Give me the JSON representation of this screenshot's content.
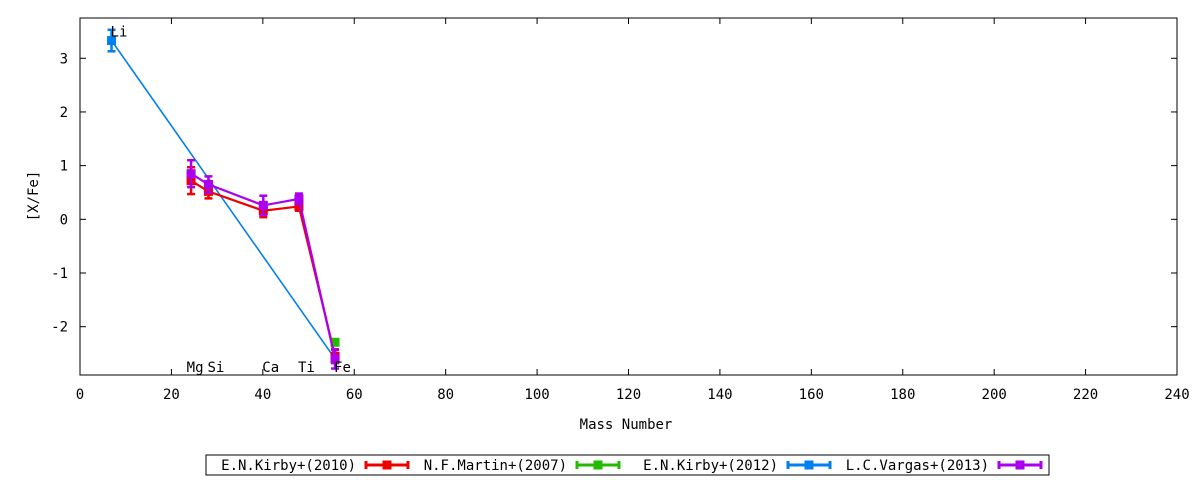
{
  "chart_data": {
    "type": "line",
    "xlabel": "Mass Number",
    "ylabel": "[X/Fe]",
    "xlim": [
      0,
      240
    ],
    "ylim": [
      -2.9,
      3.75
    ],
    "x_ticks": [
      0,
      20,
      40,
      60,
      80,
      100,
      120,
      140,
      160,
      180,
      200,
      220,
      240
    ],
    "y_ticks": [
      -2,
      -1,
      0,
      1,
      2,
      3
    ],
    "grid": false,
    "legend_position": "bottom",
    "element_labels": [
      {
        "text": "Li",
        "x": 6.9,
        "y": 3.5
      },
      {
        "text": "Mg",
        "x": 24.3,
        "y": -2.75
      },
      {
        "text": "Si",
        "x": 28.1,
        "y": -2.75
      },
      {
        "text": "Ca",
        "x": 40.1,
        "y": -2.75
      },
      {
        "text": "Ti",
        "x": 47.9,
        "y": -2.75
      },
      {
        "text": "Fe",
        "x": 55.8,
        "y": -2.75
      }
    ],
    "series": [
      {
        "name": "E.N.Kirby+(2010)",
        "color": "#ee0000",
        "points": [
          {
            "x": 24.3,
            "y": 0.72,
            "err": 0.25
          },
          {
            "x": 28.1,
            "y": 0.52,
            "err": 0.13
          },
          {
            "x": 40.1,
            "y": 0.16,
            "err": 0.12
          },
          {
            "x": 47.9,
            "y": 0.24,
            "err": 0.08
          },
          {
            "x": 55.8,
            "y": -2.55,
            "err": 0.12
          }
        ]
      },
      {
        "name": "N.F.Martin+(2007)",
        "color": "#22bb00",
        "points": [
          {
            "x": 55.8,
            "y": -2.29,
            "err": 0.05
          }
        ]
      },
      {
        "name": "E.N.Kirby+(2012)",
        "color": "#0080ee",
        "points": [
          {
            "x": 6.9,
            "y": 3.33,
            "err": 0.2
          },
          {
            "x": 55.8,
            "y": -2.6,
            "err": 0.08
          }
        ]
      },
      {
        "name": "L.C.Vargas+(2013)",
        "color": "#aa00ee",
        "points": [
          {
            "x": 24.3,
            "y": 0.85,
            "err": 0.25
          },
          {
            "x": 28.1,
            "y": 0.65,
            "err": 0.15
          },
          {
            "x": 40.1,
            "y": 0.26,
            "err": 0.18
          },
          {
            "x": 47.9,
            "y": 0.38,
            "err": 0.1
          },
          {
            "x": 55.8,
            "y": -2.6,
            "err": 0.18
          }
        ]
      }
    ]
  }
}
